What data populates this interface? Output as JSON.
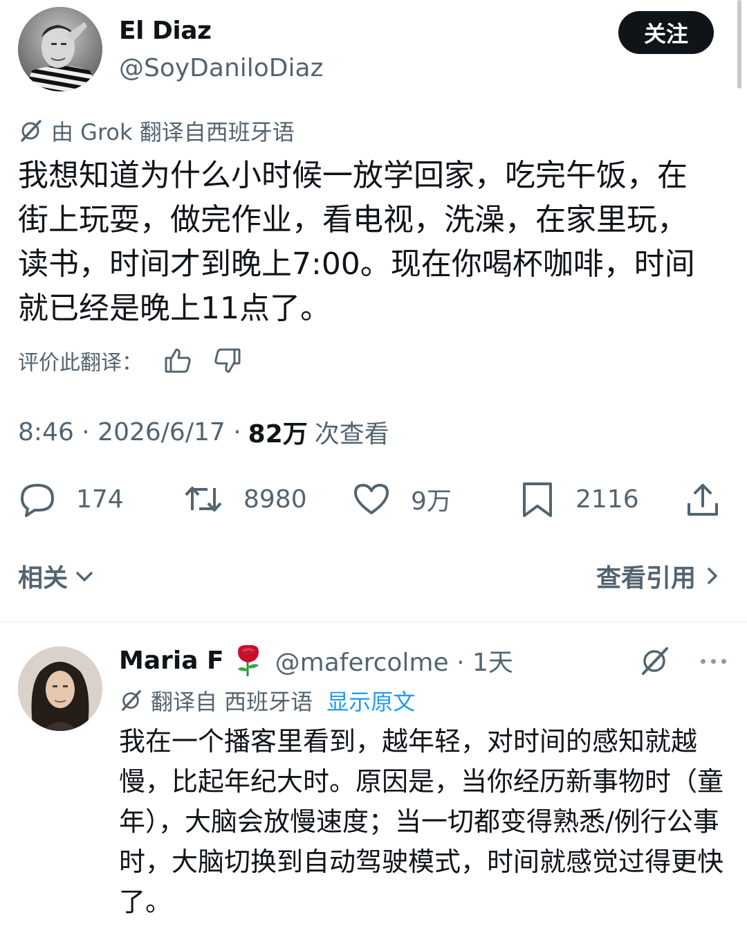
{
  "tweet": {
    "author_name": "El Diaz",
    "author_handle": "@SoyDaniloDiaz",
    "follow_label": "关注",
    "translation_note": "由 Grok 翻译自西班牙语",
    "text": "我想知道为什么小时候一放学回家，吃完午饭，在街上玩耍，做完作业，看电视，洗澡，在家里玩，读书，时间才到晚上7:00。现在你喝杯咖啡，时间就已经是晚上11点了。",
    "rate_label": "评价此翻译：",
    "time": "8:46 · 2026/6/17 ·",
    "views_count": "82万",
    "views_label": "次查看",
    "stats": {
      "replies": "174",
      "retweets": "8980",
      "likes": "9万",
      "bookmarks": "2116"
    },
    "related_label": "相关",
    "quotes_label": "查看引用"
  },
  "reply": {
    "name": "Maria F",
    "handle": "@mafercolme · 1天",
    "translation_note": "翻译自 西班牙语",
    "show_original": "显示原文",
    "text": "我在一个播客里看到，越年轻，对时间的感知就越慢，比起年纪大时。原因是，当你经历新事物时（童年），大脑会放慢速度；当一切都变得熟悉/例行公事时，大脑切换到自动驾驶模式，时间就感觉过得更快了。"
  },
  "colors": {
    "text": "#0f1419",
    "secondary": "#536471",
    "link": "#1d9bf0",
    "button_bg": "#0f1419"
  }
}
